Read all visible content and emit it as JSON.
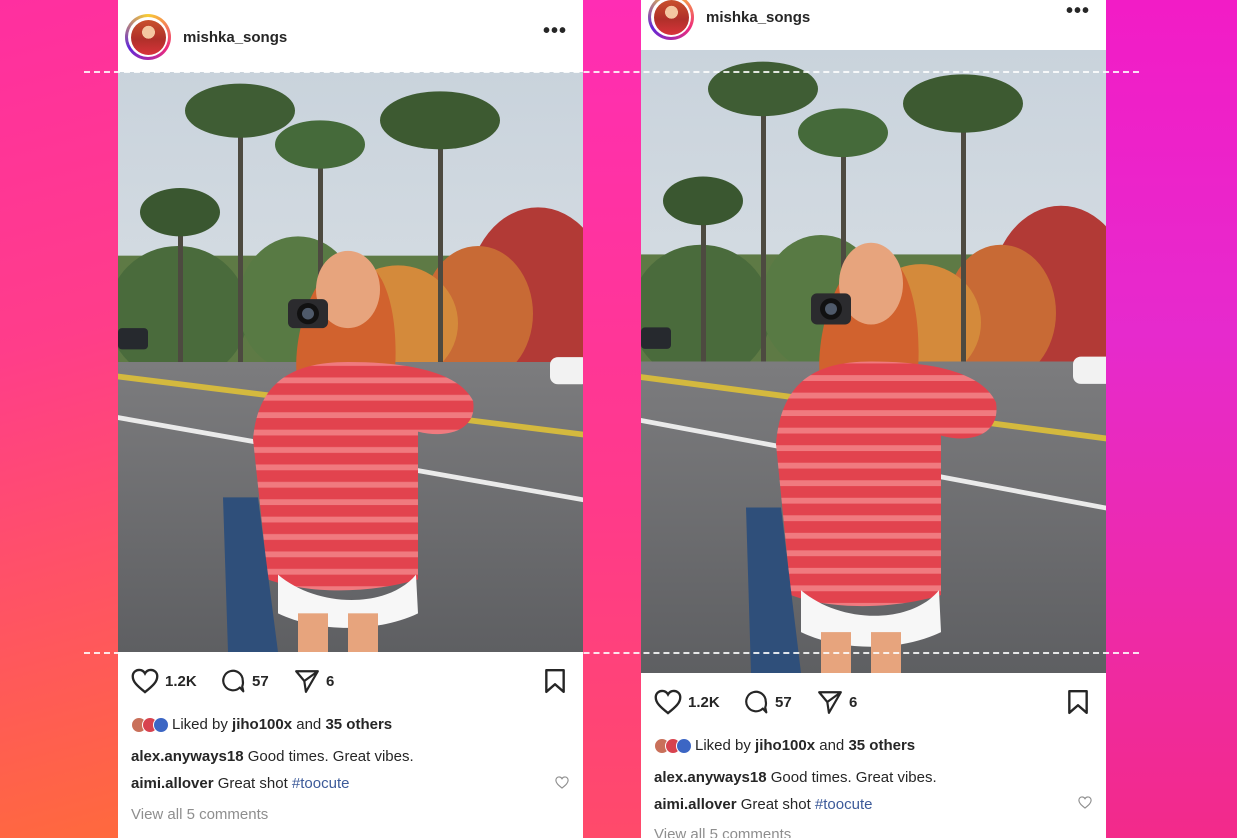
{
  "posts": [
    {
      "username": "mishka_songs",
      "more": "•••",
      "likes_count": "1.2K",
      "comments_count": "57",
      "shares_count": "6",
      "liked_by_prefix": "Liked by ",
      "liked_by_user": "jiho100x",
      "liked_by_and": " and ",
      "liked_by_others": "35 others",
      "comments": [
        {
          "user": "alex.anyways18",
          "text": " Good times. Great vibes.",
          "tag": ""
        },
        {
          "user": "aimi.allover",
          "text": " Great shot ",
          "tag": "#toocute"
        }
      ],
      "view_all": "View all 5 comments"
    },
    {
      "username": "mishka_songs",
      "more": "•••",
      "likes_count": "1.2K",
      "comments_count": "57",
      "shares_count": "6",
      "liked_by_prefix": "Liked by ",
      "liked_by_user": "jiho100x",
      "liked_by_and": " and ",
      "liked_by_others": "35 others",
      "comments": [
        {
          "user": "alex.anyways18",
          "text": " Good times. Great vibes.",
          "tag": ""
        },
        {
          "user": "aimi.allover",
          "text": " Great shot ",
          "tag": "#toocute"
        }
      ],
      "view_all": "View all 5 comments"
    }
  ],
  "icons": [
    "heart-icon",
    "comment-icon",
    "share-icon",
    "bookmark-icon",
    "more-icon"
  ],
  "colors": {
    "accent_pink": "#ff2fa0",
    "accent_orange": "#ff8a1f",
    "hashtag": "#3c5a99"
  }
}
